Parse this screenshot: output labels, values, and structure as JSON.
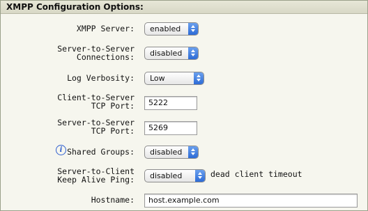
{
  "header": {
    "title": "XMPP Configuration Options:"
  },
  "rows": {
    "xmpp_server": {
      "label": "XMPP Server:",
      "value": "enabled"
    },
    "s2s": {
      "label_line1": "Server-to-Server",
      "label_line2": "Connections:",
      "value": "disabled"
    },
    "log": {
      "label": "Log Verbosity:",
      "value": "Low"
    },
    "c2s_port": {
      "label_line1": "Client-to-Server",
      "label_line2": "TCP Port:",
      "value": "5222"
    },
    "s2s_port": {
      "label_line1": "Server-to-Server",
      "label_line2": "TCP Port:",
      "value": "5269"
    },
    "shared_groups": {
      "label": "Shared Groups:",
      "value": "disabled",
      "icon": "info-icon"
    },
    "keepalive": {
      "label_line1": "Server-to-Client",
      "label_line2": "Keep Alive Ping:",
      "value": "disabled",
      "suffix": "dead client timeout"
    },
    "hostname": {
      "label": "Hostname:",
      "value": "host.example.com"
    }
  }
}
